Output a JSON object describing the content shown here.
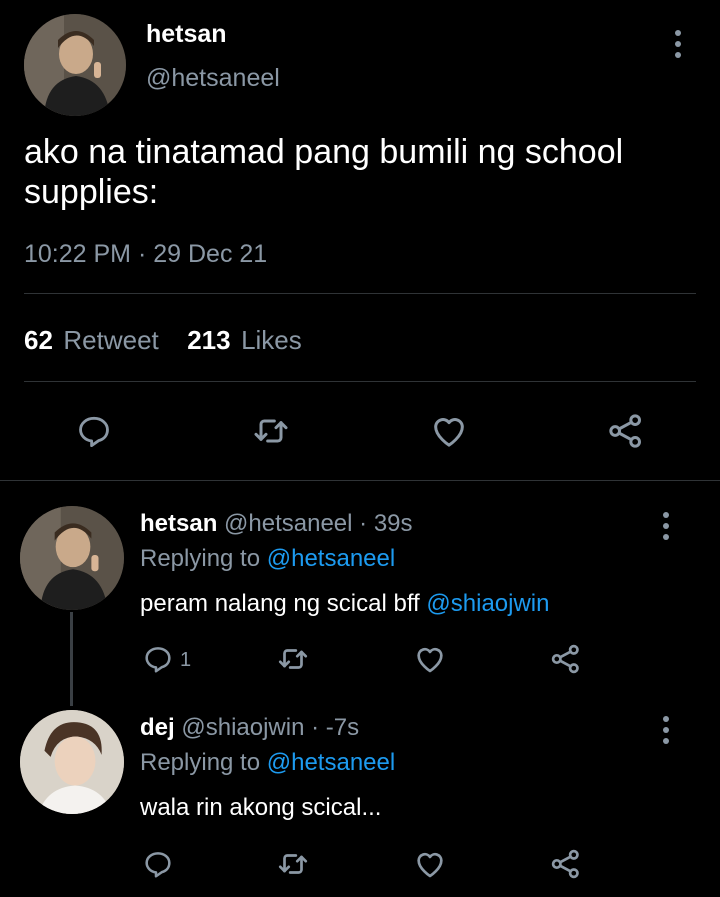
{
  "main_tweet": {
    "display_name": "hetsan",
    "handle": "@hetsaneel",
    "text": "ako na tinatamad pang bumili ng school supplies:",
    "time": "10:22 PM",
    "separator": "·",
    "date": "29 Dec 21",
    "retweet_count": "62",
    "retweet_label": "Retweet",
    "likes_count": "213",
    "likes_label": "Likes"
  },
  "replies": [
    {
      "display_name": "hetsan",
      "handle": "@hetsaneel",
      "time": "· 39s",
      "replying_prefix": "Replying to",
      "replying_to": "@hetsaneel",
      "text": "peram nalang ng scical bff",
      "mention": "@shiaojwin",
      "reply_count": "1"
    },
    {
      "display_name": "dej",
      "handle": "@shiaojwin",
      "time": "· -7s",
      "replying_prefix": "Replying to",
      "replying_to": "@hetsaneel",
      "text": "wala rin akong scical...",
      "mention": "",
      "reply_count": ""
    }
  ],
  "icons": {
    "reply": "reply-icon",
    "retweet": "retweet-icon",
    "like": "heart-icon",
    "share": "share-icon",
    "more": "more-options-icon"
  },
  "colors": {
    "background": "#000000",
    "text": "#ffffff",
    "secondary": "#8b98a5",
    "link": "#1d9bf0",
    "divider": "#2f3336"
  }
}
